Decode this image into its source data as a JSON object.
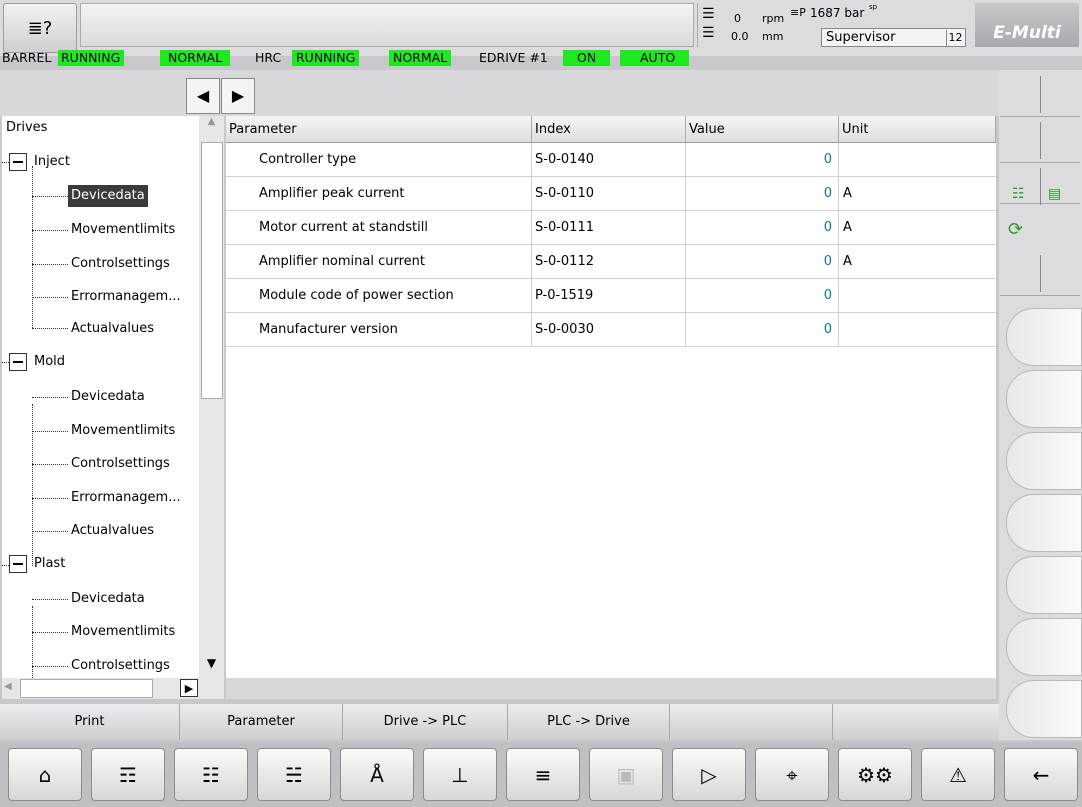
{
  "header": {
    "speed_rpm": "0",
    "speed_rpm_unit": "rpm",
    "stroke": "0.0",
    "stroke_unit": "mm",
    "pressure": "1687 bar",
    "pressure_sup": "sp",
    "user": "Supervisor",
    "user_level": "12",
    "logo": "E-Multi"
  },
  "status": {
    "barrel_label": "BARREL",
    "barrel_state": "RUNNING",
    "barrel_mode": "NORMAL",
    "hrc_label": "HRC",
    "hrc_state": "RUNNING",
    "hrc_mode": "NORMAL",
    "edrive_label": "EDRIVE #1",
    "edrive_state": "ON",
    "edrive_mode": "AUTO"
  },
  "tree": {
    "root": "Drives",
    "groups": [
      {
        "label": "Inject",
        "children": [
          "Devicedata",
          "Movementlimits",
          "Controlsettings",
          "Errormanagem...",
          "Actualvalues"
        ]
      },
      {
        "label": "Mold",
        "children": [
          "Devicedata",
          "Movementlimits",
          "Controlsettings",
          "Errormanagem...",
          "Actualvalues"
        ]
      },
      {
        "label": "Plast",
        "children": [
          "Devicedata",
          "Movementlimits",
          "Controlsettings"
        ]
      }
    ]
  },
  "table": {
    "headers": [
      "Parameter",
      "Index",
      "Value",
      "Unit"
    ],
    "rows": [
      {
        "parameter": "Controller type",
        "index": "S-0-0140",
        "value": "0",
        "unit": ""
      },
      {
        "parameter": "Amplifier peak current",
        "index": "S-0-0110",
        "value": "0",
        "unit": "A"
      },
      {
        "parameter": "Motor current at standstill",
        "index": "S-0-0111",
        "value": "0",
        "unit": "A"
      },
      {
        "parameter": "Amplifier nominal current",
        "index": "S-0-0112",
        "value": "0",
        "unit": "A"
      },
      {
        "parameter": "Module code of power section",
        "index": "P-0-1519",
        "value": "0",
        "unit": ""
      },
      {
        "parameter": "Manufacturer version",
        "index": "S-0-0030",
        "value": "0",
        "unit": ""
      }
    ]
  },
  "tabs": [
    "Print",
    "Parameter",
    "Drive -> PLC",
    "PLC -> Drive",
    "",
    ""
  ],
  "bottom_nav": [
    "home-icon",
    "inject-unit-icon",
    "barrel-icon",
    "mold-icon",
    "heating-icon",
    "ejector-icon",
    "list-icon",
    "screen-icon",
    "io-icon",
    "chart-icon",
    "settings-icon",
    "alarm-icon",
    "back-arrow-icon"
  ],
  "colors": {
    "status_green": "#1ee81e",
    "value_teal": "#0a7a8a",
    "selected_bg": "#3a3a3a"
  }
}
